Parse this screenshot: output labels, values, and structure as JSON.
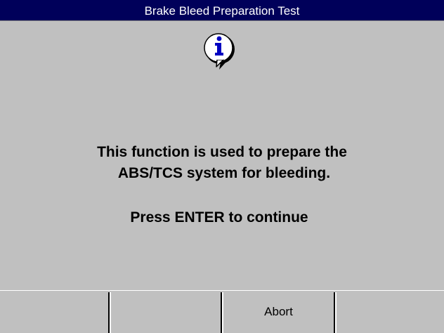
{
  "window": {
    "title": "Brake Bleed Preparation Test"
  },
  "dialog": {
    "icon": "info-icon",
    "message_line1": "This function is used to prepare the",
    "message_line2": "ABS/TCS system for bleeding.",
    "prompt": "Press ENTER to continue"
  },
  "softkeys": [
    {
      "label": ""
    },
    {
      "label": ""
    },
    {
      "label": "Abort"
    },
    {
      "label": ""
    }
  ],
  "colors": {
    "title_bar": "#00005a",
    "background": "#c0c0c0",
    "icon_letter": "#0000c0"
  }
}
